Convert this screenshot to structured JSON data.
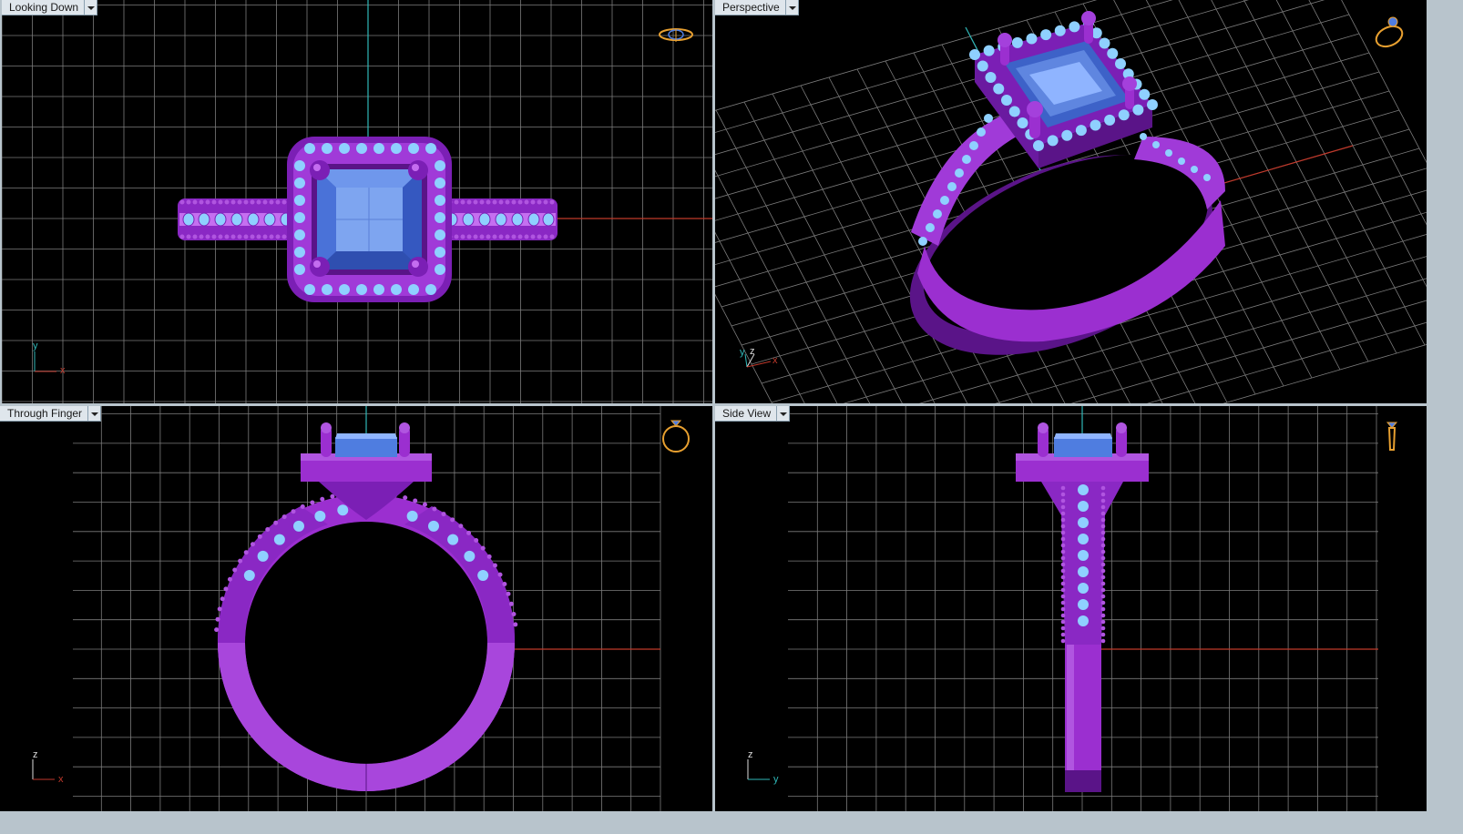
{
  "viewports": [
    {
      "id": "top",
      "label": "Looking Down",
      "axes": {
        "h": "x",
        "v": "y"
      },
      "icon": "ring-top-icon"
    },
    {
      "id": "persp",
      "label": "Perspective",
      "axes": {
        "h": "x",
        "v": "y",
        "d": "z"
      },
      "icon": "ring-perspective-icon"
    },
    {
      "id": "front",
      "label": "Through Finger",
      "axes": {
        "h": "x",
        "v": "z"
      },
      "icon": "ring-front-icon"
    },
    {
      "id": "side",
      "label": "Side View",
      "axes": {
        "h": "y",
        "v": "z"
      },
      "icon": "ring-side-icon"
    }
  ],
  "colors": {
    "grid": "#7c7c7c",
    "grid_major": "#9a9a9a",
    "axis_x": "#c0392b",
    "axis_y": "#2fb8b8",
    "metal": "#9b2fd0",
    "metal_dark": "#5a1488",
    "metal_light": "#c46df0",
    "gem": "#4f7de0",
    "gem_light": "#8fb4ff",
    "accent_stone": "#8fd0ff",
    "icon_ring": "#e8a030"
  }
}
